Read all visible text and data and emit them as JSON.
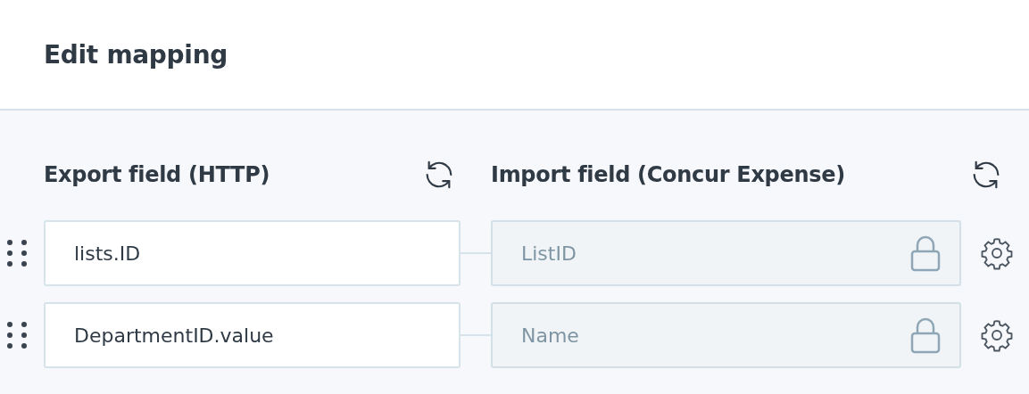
{
  "title": "Edit mapping",
  "columns": [
    {
      "heading": "Export field (HTTP)"
    },
    {
      "heading": "Import field (Concur Expense)"
    }
  ],
  "rows": [
    {
      "export_value": "lists.ID",
      "import_value": "ListID",
      "locked": true
    },
    {
      "export_value": "DepartmentID.value",
      "import_value": "Name",
      "locked": true
    }
  ]
}
